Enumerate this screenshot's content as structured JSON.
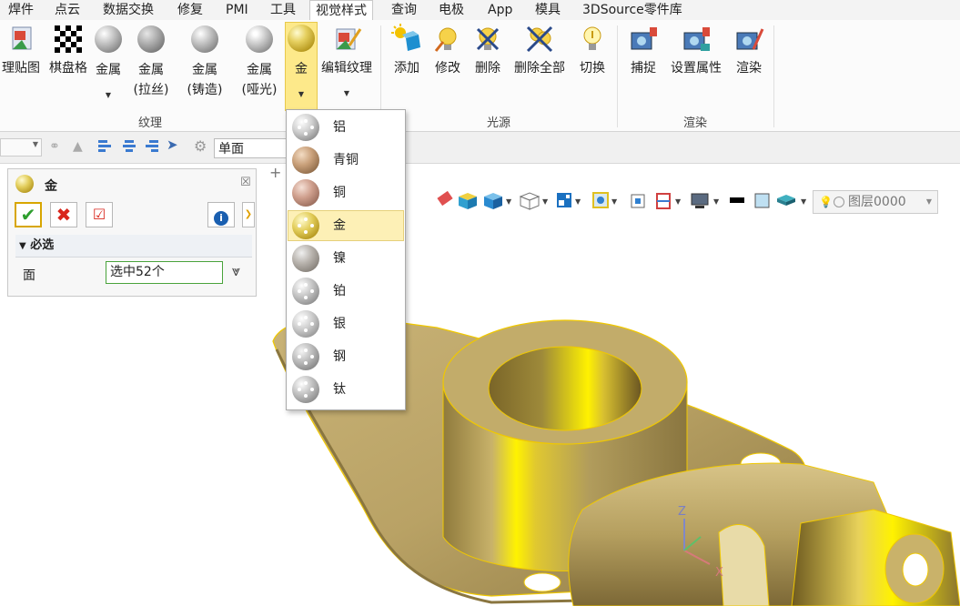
{
  "menubar": {
    "items": [
      "焊件",
      "点云",
      "数据交换",
      "修复",
      "PMI",
      "工具",
      "视觉样式",
      "查询",
      "电极",
      "App",
      "模具",
      "3DSource零件库"
    ]
  },
  "ribbon": {
    "texture_group_label": "纹理",
    "light_group_label": "光源",
    "render_group_label": "渲染",
    "texture_buttons": {
      "map": "理贴图",
      "checker": "棋盘格",
      "metal": "金属",
      "metal_brushed_1": "金属",
      "metal_brushed_2": "(拉丝)",
      "metal_cast_1": "金属",
      "metal_cast_2": "(铸造)",
      "metal_matte_1": "金属",
      "metal_matte_2": "(哑光)",
      "gold": "金",
      "edit_texture": "编辑纹理"
    },
    "light_buttons": {
      "add": "添加",
      "modify": "修改",
      "delete": "删除",
      "delete_all": "删除全部",
      "switch": "切换"
    },
    "render_buttons": {
      "capture": "捕捉",
      "set_props": "设置属性",
      "render": "渲染"
    }
  },
  "toolbar": {
    "face_filter": "单面",
    "layer": "图层0000"
  },
  "panel": {
    "title": "金",
    "section": "必选",
    "face_label": "面",
    "face_value": "选中52个"
  },
  "material_menu": {
    "items": [
      "铝",
      "青铜",
      "铜",
      "金",
      "镍",
      "铂",
      "银",
      "钢",
      "钛"
    ],
    "selected": "金"
  },
  "axis": {
    "z": "Z",
    "x": "X"
  },
  "colors": {
    "accent_gold": "#e6c400",
    "selected_bg": "#fdf0b6",
    "ok_green": "#2e9e2e",
    "cancel_red": "#d9261c"
  }
}
